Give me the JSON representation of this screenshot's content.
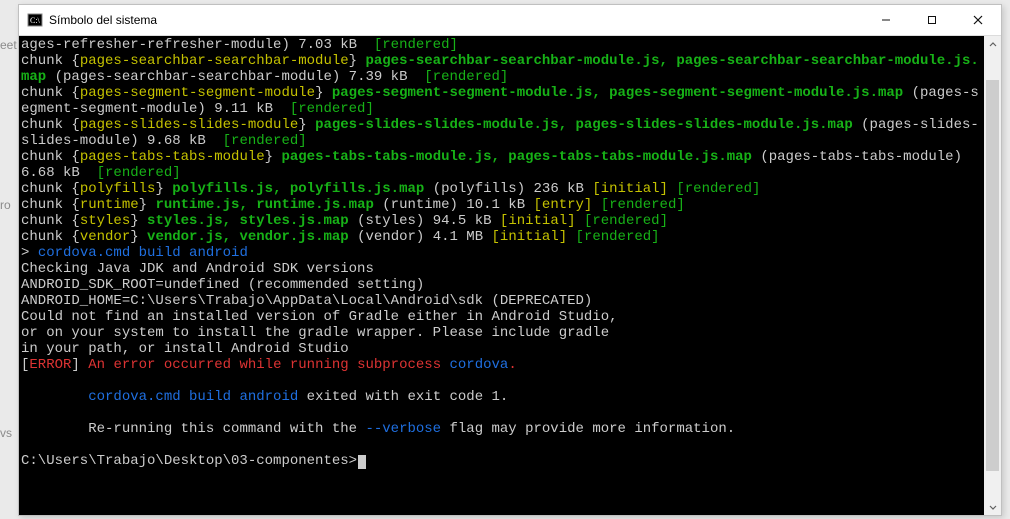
{
  "background_words": {
    "w1": "eet",
    "w2": "ro",
    "w3": "vs"
  },
  "window": {
    "title": "Símbolo del sistema",
    "min_tooltip": "Minimize",
    "max_tooltip": "Maximize",
    "close_tooltip": "Close"
  },
  "colors": {
    "term_bg": "#000000",
    "fg": "#cccccc",
    "yellow": "#c5c200",
    "green": "#17b217",
    "blue": "#1f6fe0",
    "red": "#dd3333"
  },
  "prompt": "C:\\Users\\Trabajo\\Desktop\\03-componentes>",
  "lines": [
    [
      [
        "w",
        "ages-refresher-refresher-module) 7.03 kB  "
      ],
      [
        "g",
        "[rendered]"
      ]
    ],
    [
      [
        "w",
        "chunk {"
      ],
      [
        "y",
        "pages-searchbar-searchbar-module"
      ],
      [
        "w",
        "} "
      ],
      [
        "gb",
        "pages-searchbar-searchbar-module.js, pages-searchbar-searchbar-module.js.map"
      ],
      [
        "w",
        " (pages-searchbar-searchbar-module) 7.39 kB  "
      ],
      [
        "g",
        "[rendered]"
      ]
    ],
    [
      [
        "w",
        "chunk {"
      ],
      [
        "y",
        "pages-segment-segment-module"
      ],
      [
        "w",
        "} "
      ],
      [
        "gb",
        "pages-segment-segment-module.js, pages-segment-segment-module.js.map"
      ],
      [
        "w",
        " (pages-segment-segment-module) 9.11 kB  "
      ],
      [
        "g",
        "[rendered]"
      ]
    ],
    [
      [
        "w",
        "chunk {"
      ],
      [
        "y",
        "pages-slides-slides-module"
      ],
      [
        "w",
        "} "
      ],
      [
        "gb",
        "pages-slides-slides-module.js, pages-slides-slides-module.js.map"
      ],
      [
        "w",
        " (pages-slides-slides-module) 9.68 kB  "
      ],
      [
        "g",
        "[rendered]"
      ]
    ],
    [
      [
        "w",
        "chunk {"
      ],
      [
        "y",
        "pages-tabs-tabs-module"
      ],
      [
        "w",
        "} "
      ],
      [
        "gb",
        "pages-tabs-tabs-module.js, pages-tabs-tabs-module.js.map"
      ],
      [
        "w",
        " (pages-tabs-tabs-module) 6.68 kB  "
      ],
      [
        "g",
        "[rendered]"
      ]
    ],
    [
      [
        "w",
        "chunk {"
      ],
      [
        "y",
        "polyfills"
      ],
      [
        "w",
        "} "
      ],
      [
        "gb",
        "polyfills.js, polyfills.js.map"
      ],
      [
        "w",
        " (polyfills) 236 kB "
      ],
      [
        "y",
        "[initial]"
      ],
      [
        "w",
        " "
      ],
      [
        "g",
        "[rendered]"
      ]
    ],
    [
      [
        "w",
        "chunk {"
      ],
      [
        "y",
        "runtime"
      ],
      [
        "w",
        "} "
      ],
      [
        "gb",
        "runtime.js, runtime.js.map"
      ],
      [
        "w",
        " (runtime) 10.1 kB "
      ],
      [
        "y",
        "[entry]"
      ],
      [
        "w",
        " "
      ],
      [
        "g",
        "[rendered]"
      ]
    ],
    [
      [
        "w",
        "chunk {"
      ],
      [
        "y",
        "styles"
      ],
      [
        "w",
        "} "
      ],
      [
        "gb",
        "styles.js, styles.js.map"
      ],
      [
        "w",
        " (styles) 94.5 kB "
      ],
      [
        "y",
        "[initial]"
      ],
      [
        "w",
        " "
      ],
      [
        "g",
        "[rendered]"
      ]
    ],
    [
      [
        "w",
        "chunk {"
      ],
      [
        "y",
        "vendor"
      ],
      [
        "w",
        "} "
      ],
      [
        "gb",
        "vendor.js, vendor.js.map"
      ],
      [
        "w",
        " (vendor) 4.1 MB "
      ],
      [
        "y",
        "[initial]"
      ],
      [
        "w",
        " "
      ],
      [
        "g",
        "[rendered]"
      ]
    ],
    [
      [
        "w",
        "> "
      ],
      [
        "b",
        "cordova.cmd build android"
      ]
    ],
    [
      [
        "w",
        "Checking Java JDK and Android SDK versions"
      ]
    ],
    [
      [
        "w",
        "ANDROID_SDK_ROOT=undefined (recommended setting)"
      ]
    ],
    [
      [
        "w",
        "ANDROID_HOME=C:\\Users\\Trabajo\\AppData\\Local\\Android\\sdk (DEPRECATED)"
      ]
    ],
    [
      [
        "w",
        "Could not find an installed version of Gradle either in Android Studio,"
      ]
    ],
    [
      [
        "w",
        "or on your system to install the gradle wrapper. Please include gradle"
      ]
    ],
    [
      [
        "w",
        "in your path, or install Android Studio"
      ]
    ],
    [
      [
        "w",
        "["
      ],
      [
        "r",
        "ERROR"
      ],
      [
        "w",
        "] "
      ],
      [
        "r",
        "An error occurred while running subprocess "
      ],
      [
        "b",
        "cordova"
      ],
      [
        "r",
        "."
      ]
    ],
    [
      [
        "w",
        ""
      ]
    ],
    [
      [
        "w",
        "        "
      ],
      [
        "b",
        "cordova.cmd build android"
      ],
      [
        "w",
        " exited with exit code 1."
      ]
    ],
    [
      [
        "w",
        ""
      ]
    ],
    [
      [
        "w",
        "        Re-running this command with the "
      ],
      [
        "b",
        "--verbose"
      ],
      [
        "w",
        " flag may provide more information."
      ]
    ],
    [
      [
        "w",
        ""
      ]
    ]
  ],
  "scrollbar": {
    "thumb_top_pct": 6,
    "thumb_height_pct": 88
  }
}
